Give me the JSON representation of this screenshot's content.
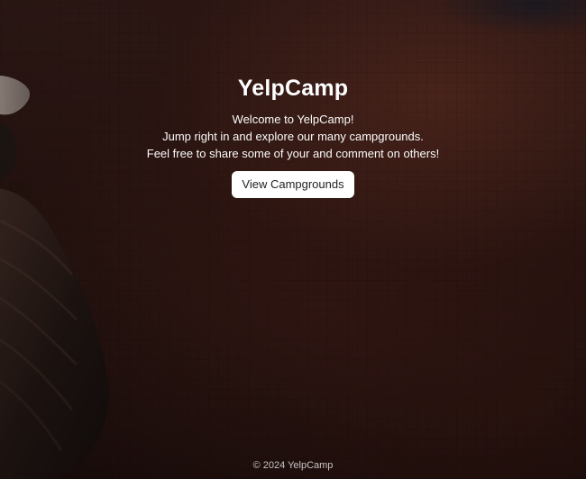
{
  "hero": {
    "title": "YelpCamp",
    "welcome": "Welcome to YelpCamp!",
    "line2": "Jump right in and explore our many campgrounds.",
    "line3": "Feel free to share some of your and comment on others!",
    "cta_label": "View Campgrounds"
  },
  "footer": {
    "copyright": "© 2024 YelpCamp"
  },
  "colors": {
    "overlay": "#000000",
    "button_bg": "#ffffff",
    "text": "#ffffff"
  }
}
